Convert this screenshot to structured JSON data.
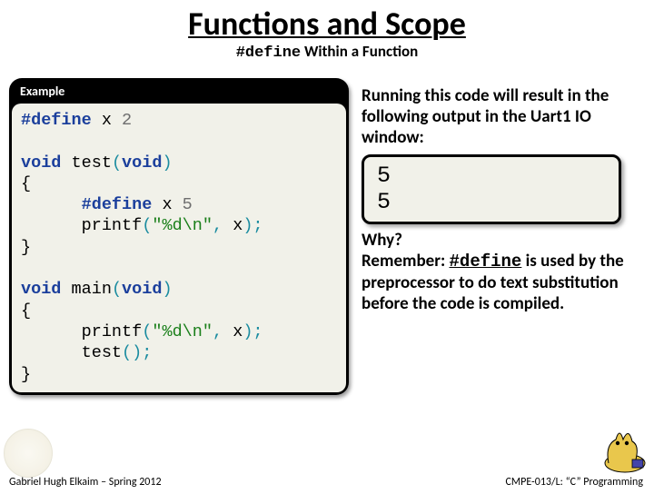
{
  "title": "Functions and Scope",
  "subtitle_prefix": "#define",
  "subtitle_rest": " Within a Function",
  "example_label": "Example",
  "code": {
    "l1_define": "#define",
    "l1_x": " x ",
    "l1_two": "2",
    "l3_void": "void",
    "l3_test": " test",
    "l3_open": "(",
    "l3_voidarg": "void",
    "l3_close": ")",
    "l4_brace": "{",
    "l5_indent": "      ",
    "l5_define": "#define",
    "l5_x": " x ",
    "l5_five": "5",
    "l6_indent": "      ",
    "l6_printf": "printf",
    "l6_open": "(",
    "l6_str": "\"%d\\n\"",
    "l6_comma": ",",
    "l6_x": " x",
    "l6_close": ");",
    "l7_brace": "}",
    "l9_void": "void",
    "l9_main": " main",
    "l9_open": "(",
    "l9_voidarg": "void",
    "l9_close": ")",
    "l10_brace": "{",
    "l11_indent": "      ",
    "l11_printf": "printf",
    "l11_open": "(",
    "l11_str": "\"%d\\n\"",
    "l11_comma": ",",
    "l11_x": " x",
    "l11_close": ");",
    "l12_indent": "      ",
    "l12_test": "test",
    "l12_open": "();",
    "l13_brace": "}"
  },
  "right": {
    "intro": "Running this code will result in the following output in the Uart1 IO window:",
    "out1": "5",
    "out2": "5",
    "why": "Why?",
    "remember_prefix": "Remember: ",
    "remember_define": "#define",
    "remember_rest": " is used by the preprocessor to do text substitution before the code is compiled."
  },
  "footer_left": "Gabriel Hugh Elkaim – Spring 2012",
  "footer_right": "CMPE-013/L: “C” Programming"
}
